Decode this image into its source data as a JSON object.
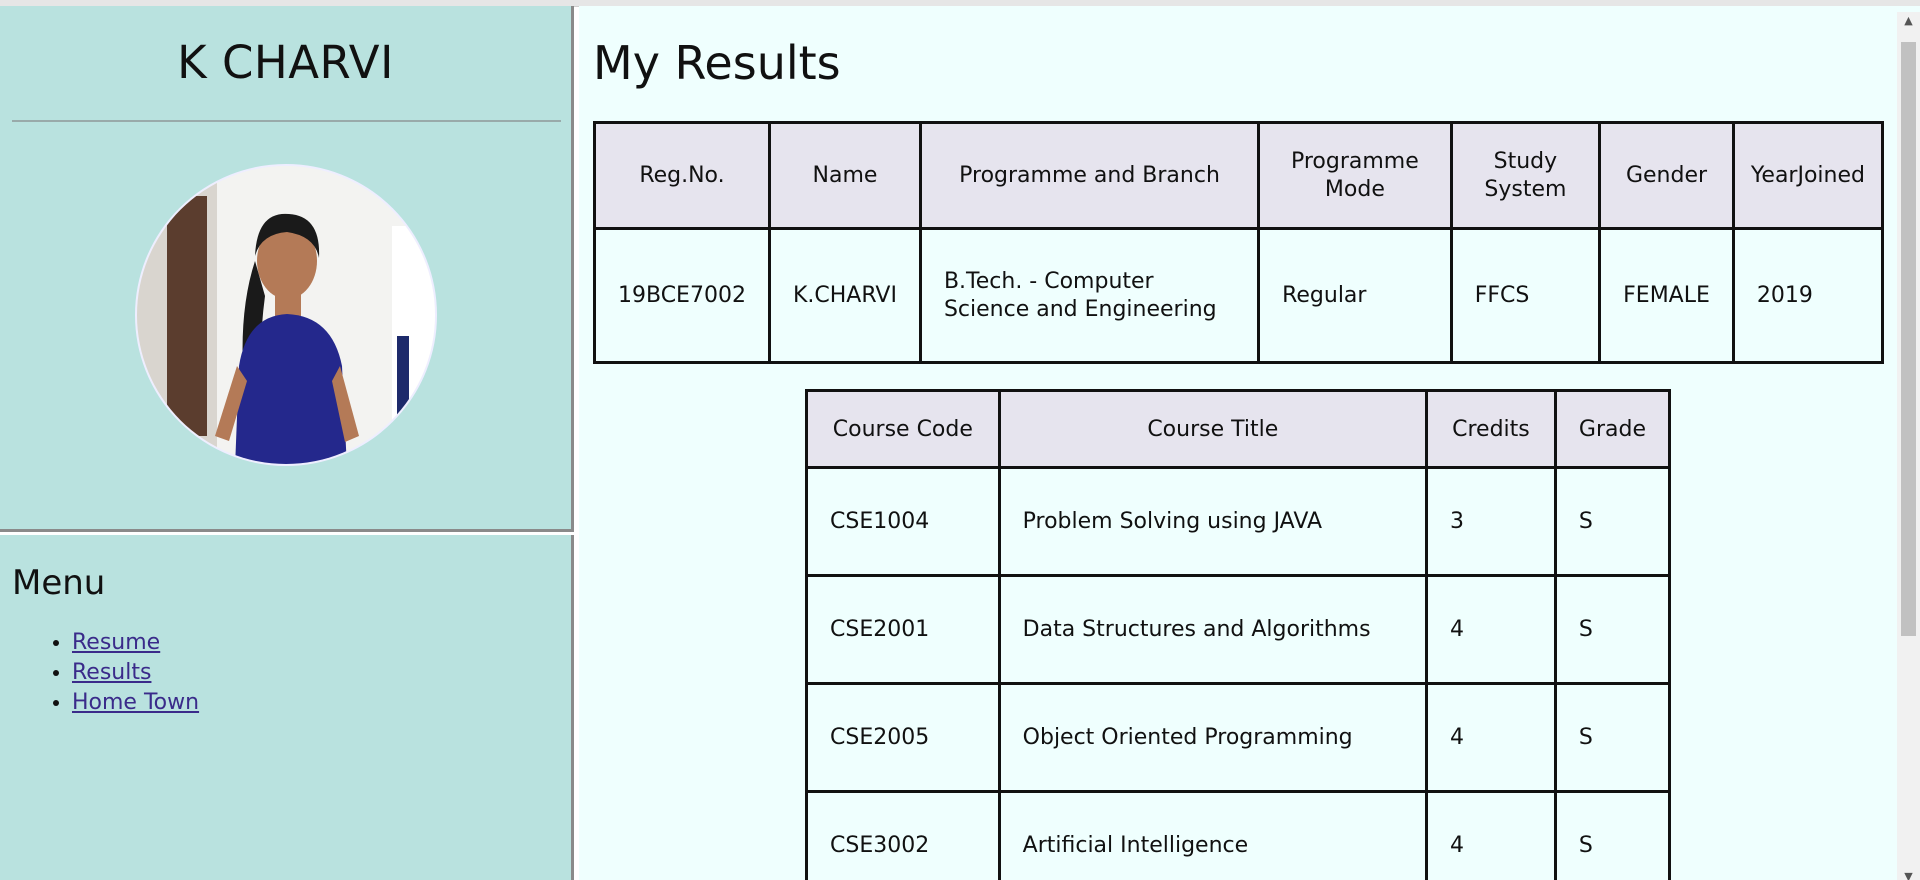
{
  "sidebar": {
    "name": "K CHARVI",
    "menu_title": "Menu",
    "menu_items": [
      {
        "label": "Resume"
      },
      {
        "label": "Results"
      },
      {
        "label": "Home Town"
      }
    ]
  },
  "main": {
    "title": "My Results",
    "info_table": {
      "headers": [
        "Reg.No.",
        "Name",
        "Programme and Branch",
        "Programme Mode",
        "Study System",
        "Gender",
        "YearJoined"
      ],
      "row": [
        "19BCE7002",
        "K.CHARVI",
        "B.Tech. - Computer Science and Engineering",
        "Regular",
        "FFCS",
        "FEMALE",
        "2019"
      ]
    },
    "course_table": {
      "headers": [
        "Course Code",
        "Course Title",
        "Credits",
        "Grade"
      ],
      "rows": [
        [
          "CSE1004",
          "Problem Solving using JAVA",
          "3",
          "S"
        ],
        [
          "CSE2001",
          "Data Structures and Algorithms",
          "4",
          "S"
        ],
        [
          "CSE2005",
          "Object Oriented Programming",
          "4",
          "S"
        ],
        [
          "CSE3002",
          "Artificial Intelligence",
          "4",
          "S"
        ]
      ]
    }
  },
  "colors": {
    "sidebar_bg": "#b9e2df",
    "main_bg": "#effffe",
    "header_bg": "#e6e4ee",
    "link": "#3a2b8a"
  }
}
